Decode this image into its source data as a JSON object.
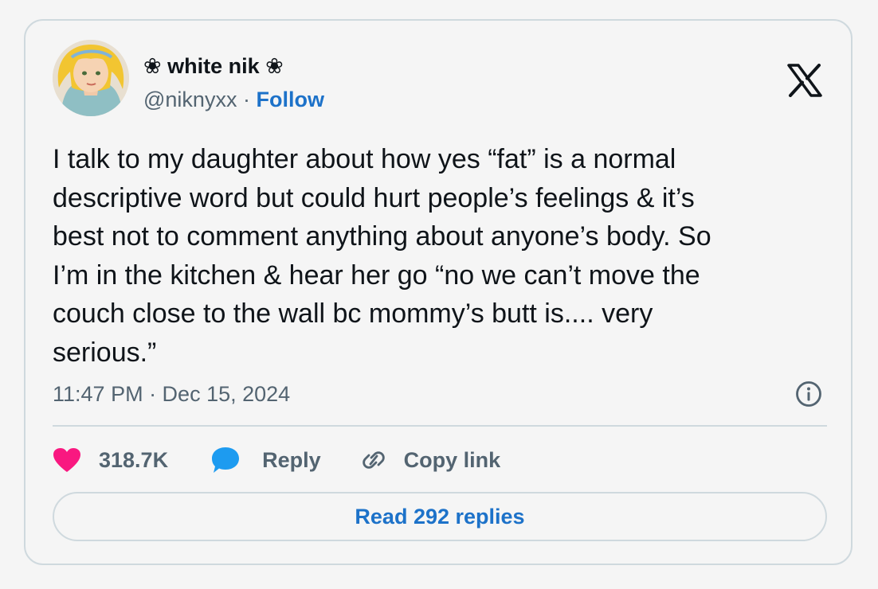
{
  "author": {
    "display_name": "❀ white nik ❀",
    "handle": "@niknyxx",
    "separator": "·",
    "follow_label": "Follow"
  },
  "tweet": {
    "lines": [
      "I talk to my daughter about how yes “fat” is a normal",
      "descriptive word but could hurt people’s feelings & it’s",
      "best not to comment anything about anyone’s body. So",
      "I’m in the kitchen & hear her go “no we can’t move the",
      "couch close to the wall bc mommy’s butt is.... very",
      "serious.”"
    ],
    "timestamp": "11:47 PM · Dec 15, 2024"
  },
  "actions": {
    "like_count": "318.7K",
    "reply_label": "Reply",
    "copy_link_label": "Copy link"
  },
  "read_replies_label": "Read 292 replies",
  "icons": {
    "logo": "x-logo-icon",
    "info": "info-icon",
    "like": "heart-icon",
    "reply": "speech-bubble-icon",
    "copy": "link-icon"
  },
  "colors": {
    "link_blue": "#1d72c9",
    "heart_pink": "#f91880",
    "reply_blue": "#1d9bf0",
    "text_dark": "#0f1419",
    "text_gray": "#536471",
    "border": "#cfd9de"
  }
}
